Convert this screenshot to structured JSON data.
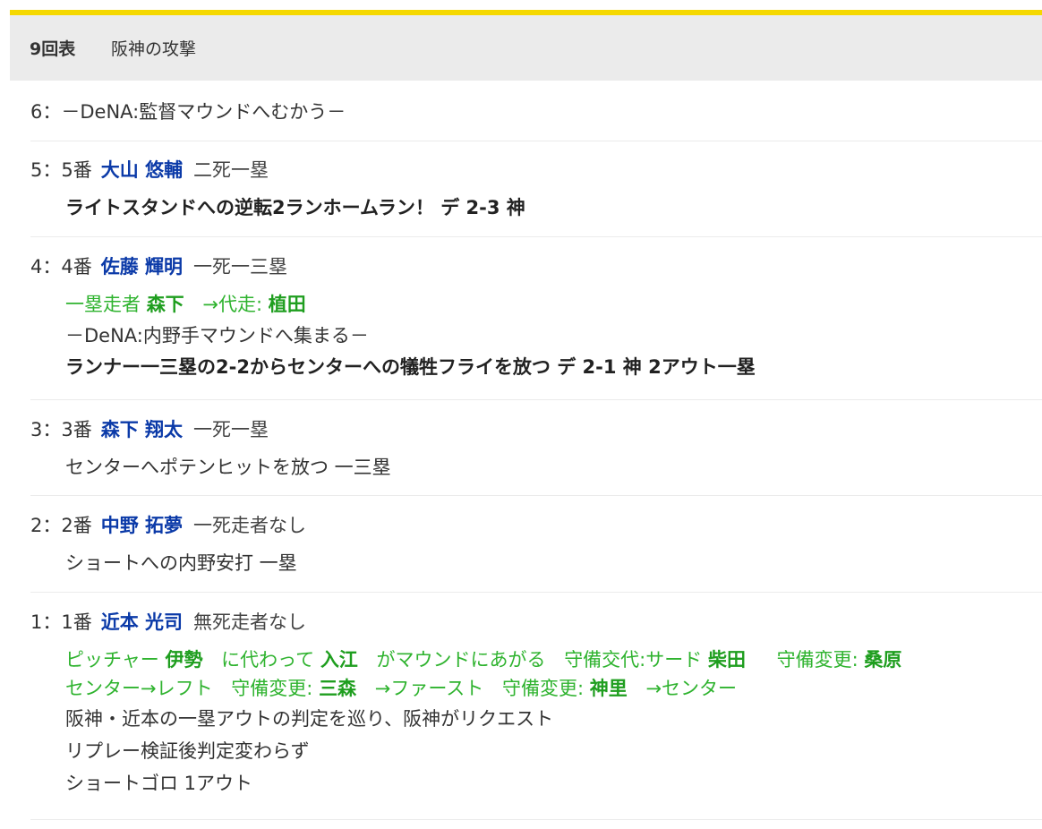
{
  "header": {
    "inning": "9回表",
    "team_attack": "阪神の攻撃"
  },
  "plays": [
    {
      "num": "6：",
      "lines": [
        "－DeNA:監督マウンドへむかう－"
      ]
    },
    {
      "num": "5：5番",
      "batter": "大山 悠輔",
      "situation": "二死一塁",
      "result": "ライトスタンドへの逆転2ランホームラン！ デ 2-3 神"
    },
    {
      "num": "4：4番",
      "batter": "佐藤 輝明",
      "situation": "一死一三塁",
      "sub": {
        "label1": "一塁走者",
        "name1": "森下",
        "label2": "→代走:",
        "name2": "植田"
      },
      "note": "－DeNA:内野手マウンドへ集まる－",
      "result": "ランナー一三塁の2-2からセンターへの犠牲フライを放つ デ 2-1 神 2アウト一塁"
    },
    {
      "num": "3：3番",
      "batter": "森下 翔太",
      "situation": "一死一塁",
      "result": "センターへポテンヒットを放つ 一三塁"
    },
    {
      "num": "2：2番",
      "batter": "中野 拓夢",
      "situation": "一死走者なし",
      "result": "ショートへの内野安打 一塁"
    },
    {
      "num": "1：1番",
      "batter": "近本 光司",
      "situation": "無死走者なし",
      "changes1": {
        "a": "ピッチャー",
        "b": "伊勢",
        "c": "に代わって",
        "d": "入江",
        "e": "がマウンドにあがる",
        "f": "守備交代:サード",
        "g": "柴田",
        "h": "守備変更:",
        "i": "桑原"
      },
      "changes2": {
        "a": "センター→レフト",
        "b": "守備変更:",
        "c": "三森",
        "d": "→ファースト",
        "e": "守備変更:",
        "f": "神里",
        "g": "→センター"
      },
      "notes": [
        "阪神・近本の一塁アウトの判定を巡り、阪神がリクエスト",
        "リプレー検証後判定変わらず",
        "ショートゴロ 1アウト"
      ]
    }
  ],
  "colors": {
    "accent_bar": "#f5d800",
    "header_bg": "#ebebeb",
    "batter": "#0b3aa8",
    "substitution": "#2fb32f"
  }
}
